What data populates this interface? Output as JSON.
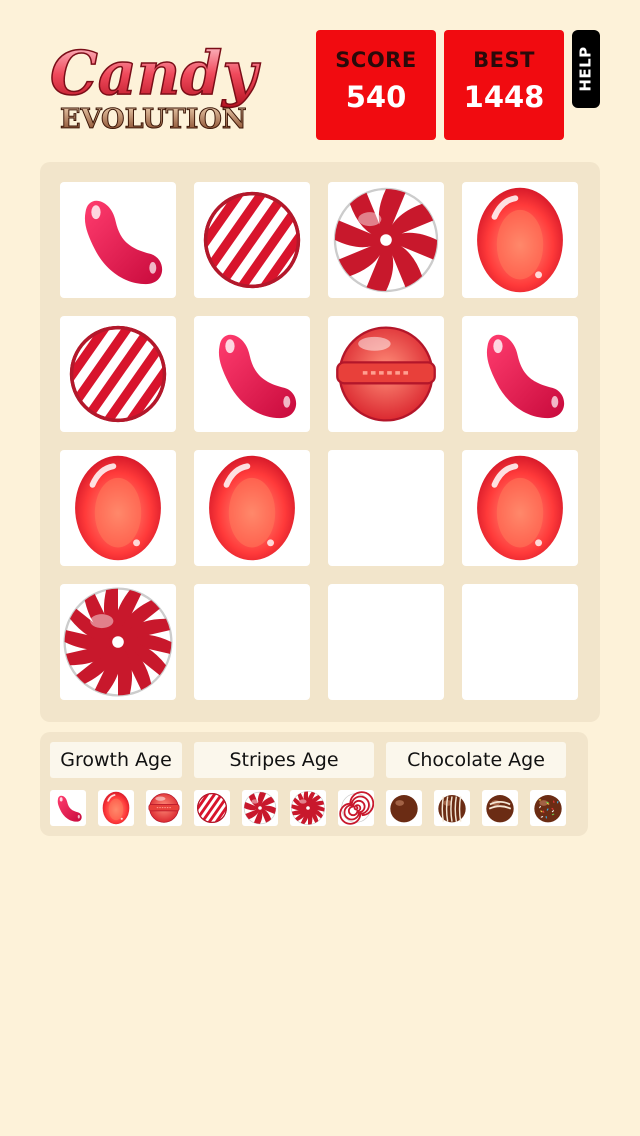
{
  "header": {
    "logo_text_top": "Candy",
    "logo_text_bottom": "EVOLUTION",
    "score_label": "SCORE",
    "score_value": "540",
    "best_label": "BEST",
    "best_value": "1448",
    "help_label": "HELP"
  },
  "colors": {
    "background": "#fdf2d9",
    "board": "#f2e5cb",
    "score_box": "#f10b10",
    "help_button": "#000000",
    "candy_red": "#e0102a"
  },
  "board": {
    "rows": [
      [
        "jellybean",
        "striped-ball",
        "peppermint",
        "gumdrop"
      ],
      [
        "striped-ball",
        "jellybean",
        "wrapped-ball",
        "jellybean"
      ],
      [
        "gumdrop",
        "gumdrop",
        "empty",
        "gumdrop"
      ],
      [
        "swirl-peppermint",
        "empty",
        "empty",
        "empty"
      ]
    ]
  },
  "legend": {
    "ages": [
      "Growth Age",
      "Stripes Age",
      "Chocolate Age"
    ],
    "evolution": [
      "jellybean",
      "gumdrop",
      "wrapped-ball",
      "striped-ball",
      "peppermint",
      "swirl-peppermint",
      "spiral-lollipop",
      "chocolate-truffle",
      "striped-truffle",
      "drizzle-truffle",
      "sprinkle-truffle"
    ]
  }
}
